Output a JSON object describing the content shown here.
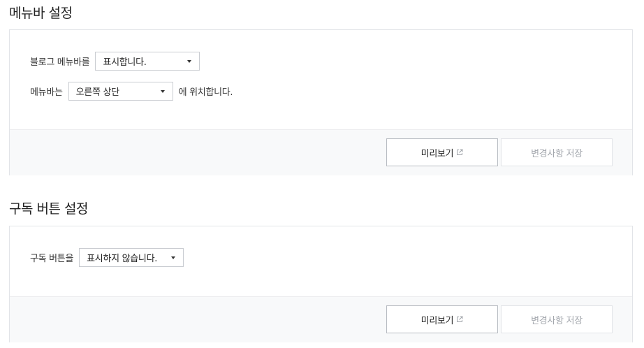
{
  "menubar_section": {
    "title": "메뉴바 설정",
    "blog_menubar_label": "블로그 메뉴바를",
    "blog_menubar_value": "표시합니다.",
    "menubar_position_label": "메뉴바는",
    "menubar_position_value": "오른쪽 상단",
    "menubar_position_suffix": "에 위치합니다.",
    "preview_label": "미리보기",
    "save_label": "변경사항 저장"
  },
  "subscribe_section": {
    "title": "구독 버튼 설정",
    "subscribe_label": "구독 버튼을",
    "subscribe_value": "표시하지 않습니다.",
    "preview_label": "미리보기",
    "save_label": "변경사항 저장"
  },
  "icons": {
    "dropdown": "caret-down-icon",
    "external": "external-link-icon"
  }
}
